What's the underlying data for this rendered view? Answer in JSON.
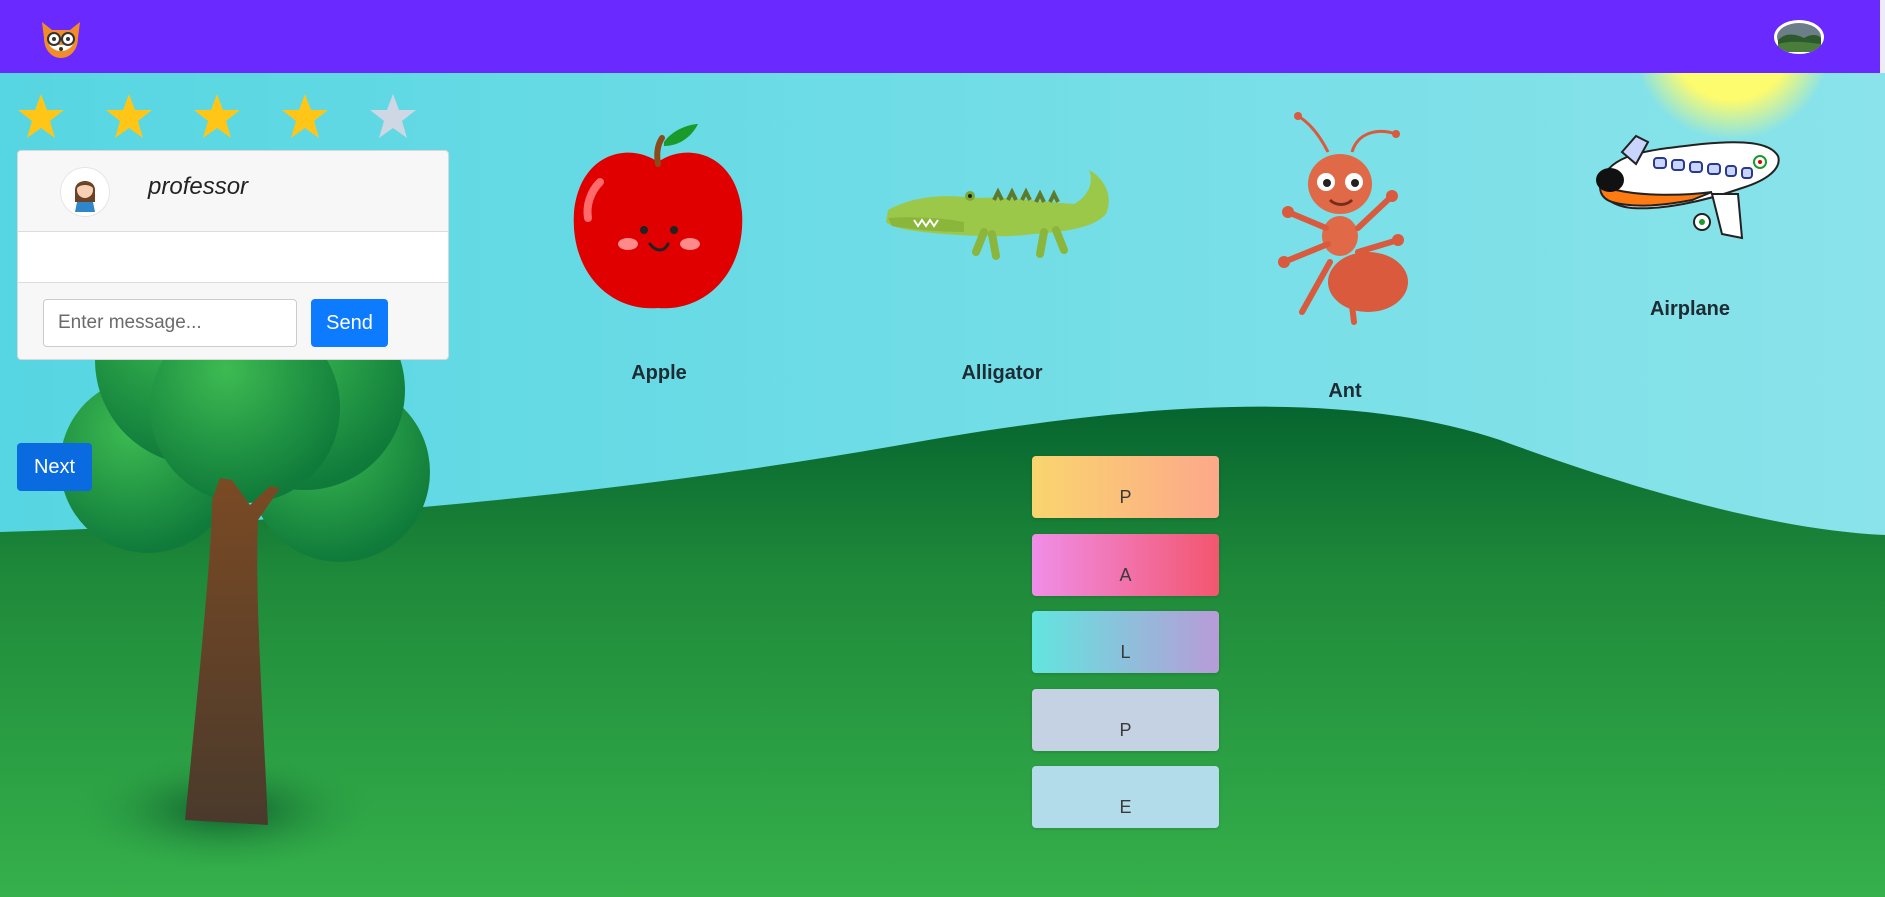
{
  "navbar": {
    "logo_icon": "fox-with-glasses-icon",
    "avatar_icon": "landscape-thumbnail-icon",
    "background": "#6a29ff"
  },
  "stars": {
    "filled": 4,
    "total": 5,
    "filled_color": "#ffc617",
    "empty_color": "#cfd6e4"
  },
  "chat": {
    "username": "professor",
    "avatar_icon": "girl-avatar-icon",
    "input_placeholder": "Enter message...",
    "input_value": "",
    "send_label": "Send"
  },
  "next_label": "Next",
  "pictures": [
    {
      "label": "Apple",
      "icon": "apple-icon"
    },
    {
      "label": "Alligator",
      "icon": "alligator-icon"
    },
    {
      "label": "Ant",
      "icon": "ant-icon"
    },
    {
      "label": "Airplane",
      "icon": "airplane-icon"
    }
  ],
  "letter_tiles": [
    "P",
    "A",
    "L",
    "P",
    "E"
  ],
  "scene": {
    "sky_color": "#5fd8e0",
    "grass_color": "#2a9e3e",
    "sun_color": "#fdf76a"
  }
}
